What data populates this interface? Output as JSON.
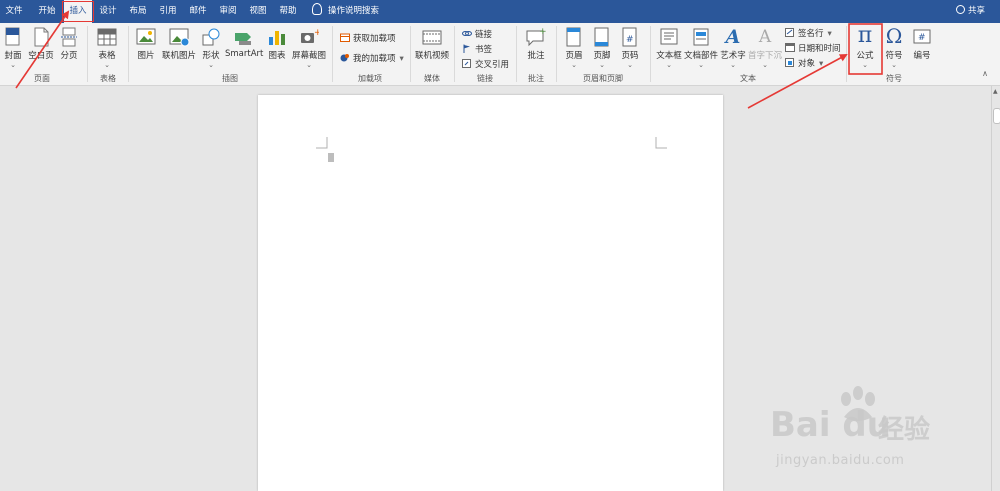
{
  "tabs": [
    {
      "label": "文件"
    },
    {
      "label": "开始"
    },
    {
      "label": "插入"
    },
    {
      "label": "设计"
    },
    {
      "label": "布局"
    },
    {
      "label": "引用"
    },
    {
      "label": "邮件"
    },
    {
      "label": "审阅"
    },
    {
      "label": "视图"
    },
    {
      "label": "帮助"
    }
  ],
  "search": {
    "label": "操作说明搜索"
  },
  "share": {
    "label": "共享"
  },
  "ribbon": {
    "pages": {
      "cover": "封面",
      "blank": "空白页",
      "break": "分页",
      "group": "页面"
    },
    "table": {
      "table": "表格",
      "group": "表格"
    },
    "illustrations": {
      "picture": "图片",
      "online_picture": "联机图片",
      "shapes": "形状",
      "smartart": "SmartArt",
      "chart": "图表",
      "screenshot": "屏幕截图",
      "group": "插图"
    },
    "addins": {
      "get": "获取加载项",
      "my": "我的加载项",
      "group": "加载项"
    },
    "media": {
      "online_video": "联机视频",
      "group": "媒体"
    },
    "links": {
      "link": "链接",
      "bookmark": "书签",
      "cross_ref": "交叉引用",
      "group": "链接"
    },
    "comments": {
      "comment": "批注",
      "group": "批注"
    },
    "header_footer": {
      "header": "页眉",
      "footer": "页脚",
      "page_number": "页码",
      "group": "页眉和页脚"
    },
    "text": {
      "textbox": "文本框",
      "quick_parts": "文档部件",
      "wordart": "艺术字",
      "dropcap": "首字下沉",
      "signature": "签名行",
      "datetime": "日期和时间",
      "object": "对象",
      "group": "文本"
    },
    "symbols": {
      "equation": "公式",
      "symbol": "符号",
      "numbering": "编号",
      "group": "符号"
    }
  },
  "icons": {
    "pi": "π",
    "omega": "Ω",
    "wordart": "A",
    "dropcap": "A",
    "hash": "#"
  },
  "watermark": {
    "logo": "Bai du",
    "cn": "经验",
    "url": "jingyan.baidu.com"
  },
  "colors": {
    "tabbar": "#2b579a",
    "highlight": "#e53935",
    "ribbon": "#f3f3f3"
  }
}
